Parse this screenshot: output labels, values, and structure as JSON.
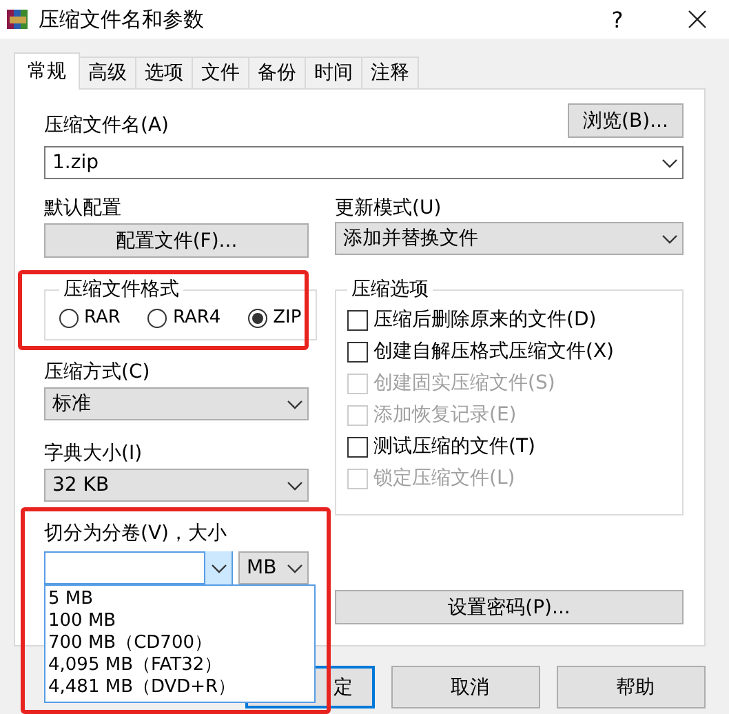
{
  "window": {
    "title": "压缩文件名和参数",
    "help": "?"
  },
  "tabs": [
    {
      "label": "常规",
      "selected": true
    },
    {
      "label": "高级",
      "selected": false
    },
    {
      "label": "选项",
      "selected": false
    },
    {
      "label": "文件",
      "selected": false
    },
    {
      "label": "备份",
      "selected": false
    },
    {
      "label": "时间",
      "selected": false
    },
    {
      "label": "注释",
      "selected": false
    }
  ],
  "archive_name": {
    "label": "压缩文件名(A)",
    "value": "1.zip",
    "browse": "浏览(B)..."
  },
  "profile": {
    "label": "默认配置",
    "button": "配置文件(F)..."
  },
  "update_mode": {
    "label": "更新模式(U)",
    "value": "添加并替换文件"
  },
  "format": {
    "label": "压缩文件格式",
    "highlight": true,
    "options": [
      {
        "label": "RAR",
        "selected": false
      },
      {
        "label": "RAR4",
        "selected": false
      },
      {
        "label": "ZIP",
        "selected": true
      }
    ]
  },
  "method": {
    "label": "压缩方式(C)",
    "value": "标准"
  },
  "dictionary": {
    "label": "字典大小(I)",
    "value": "32 KB"
  },
  "split": {
    "label": "切分为分卷(V)，大小",
    "unit": "MB",
    "expanded": true,
    "highlight": true,
    "options": [
      "5 MB",
      "100 MB",
      "700 MB（CD700）",
      "4,095 MB（FAT32）",
      "4,481 MB（DVD+R）"
    ]
  },
  "options": {
    "label": "压缩选项",
    "items": [
      {
        "label": "压缩后删除原来的文件(D)",
        "checked": false,
        "disabled": false
      },
      {
        "label": "创建自解压格式压缩文件(X)",
        "checked": false,
        "disabled": false
      },
      {
        "label": "创建固实压缩文件(S)",
        "checked": false,
        "disabled": true
      },
      {
        "label": "添加恢复记录(E)",
        "checked": false,
        "disabled": true
      },
      {
        "label": "测试压缩的文件(T)",
        "checked": false,
        "disabled": false
      },
      {
        "label": "锁定压缩文件(L)",
        "checked": false,
        "disabled": true
      }
    ]
  },
  "password_button": "设置密码(P)...",
  "buttons": [
    {
      "label": "定",
      "kind": "default"
    },
    {
      "label": "取消",
      "kind": "normal"
    },
    {
      "label": "帮助",
      "kind": "normal"
    }
  ]
}
